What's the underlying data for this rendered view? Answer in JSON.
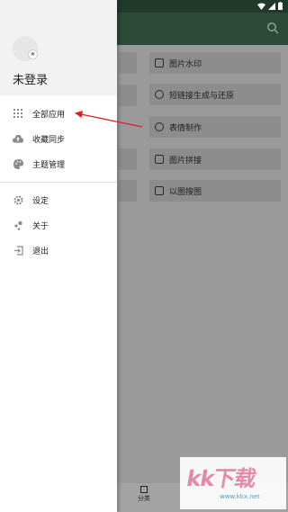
{
  "statusbar": {
    "time": ""
  },
  "background_app": {
    "rows": [
      {
        "label": "图片水印",
        "icon": "image-watermark-icon"
      },
      {
        "label": "短链接生成与还原",
        "icon": "link-icon"
      },
      {
        "label": "表情制作",
        "icon": "smiley-icon"
      },
      {
        "label": "图片拼接",
        "icon": "image-stitch-icon"
      },
      {
        "label": "以图搜图",
        "icon": "image-search-icon"
      }
    ],
    "bottom_tab": {
      "label": "分类",
      "icon": "category-icon"
    }
  },
  "drawer": {
    "username": "未登录",
    "menu_top": [
      {
        "label": "全部应用",
        "icon": "grid-icon"
      },
      {
        "label": "收藏同步",
        "icon": "cloud-upload-icon"
      },
      {
        "label": "主题管理",
        "icon": "palette-icon"
      }
    ],
    "menu_bottom": [
      {
        "label": "设定",
        "icon": "settings-icon"
      },
      {
        "label": "关于",
        "icon": "about-icon"
      },
      {
        "label": "退出",
        "icon": "exit-icon"
      }
    ]
  },
  "annotation": {
    "arrow_color": "#e02020"
  },
  "watermark": {
    "text": "kk下载",
    "url": "www.kkx.net"
  }
}
